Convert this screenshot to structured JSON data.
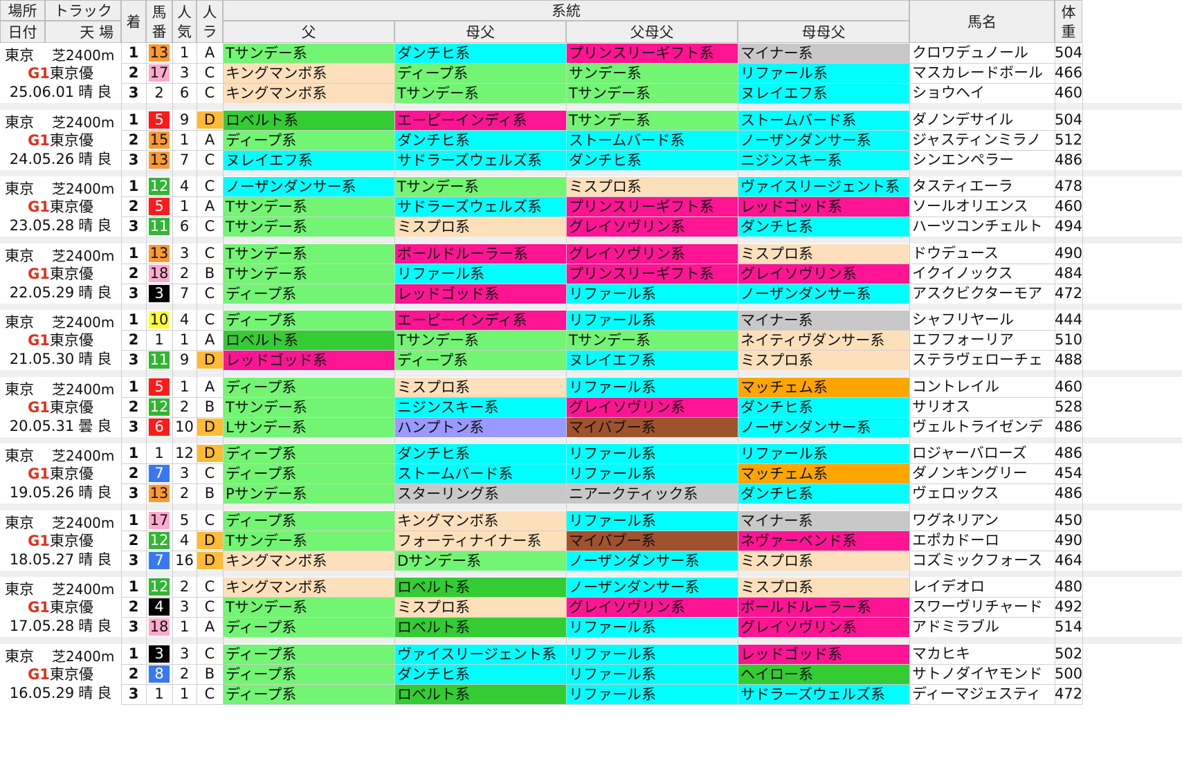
{
  "header": {
    "place": "場所",
    "date": "日付",
    "track": "トラック",
    "cond": "天 場",
    "rank": "着",
    "horse_no": "馬番",
    "popularity": "人気",
    "rank_class": "人ラ",
    "lineage": "系統",
    "sire": "父",
    "dam_sire": "母父",
    "sire_sire": "父母父",
    "dam_dam_sire": "母母父",
    "horse_name": "馬名",
    "weight": "体重"
  },
  "colors": {
    "Tサンデー系": "#72f572",
    "Lサンデー系": "#72f572",
    "Pサンデー系": "#72f572",
    "Dサンデー系": "#72f572",
    "ディープ系": "#72f572",
    "サンデー系": "#72f572",
    "キングマンボ系": "#fde0bb",
    "ミスプロ系": "#fde0bb",
    "ノーザンダンサー系": "#00ffff",
    "ストームバード系": "#00ffff",
    "ダンチヒ系": "#00ffff",
    "リファール系": "#00ffff",
    "ヌレイエフ系": "#00ffff",
    "ニジンスキー系": "#00ffff",
    "サドラーズウェルズ系": "#00ffff",
    "ヴァイスリージェント系": "#00ffff",
    "ロベルト系": "#33cc33",
    "ヘイロー系": "#33cc33",
    "エーピーインディ系": "#ff1493",
    "プリンスリーギフト系": "#ff1493",
    "レッドゴッド系": "#ff1493",
    "グレイソヴリン系": "#ff1493",
    "ボールドルーラー系": "#ff1493",
    "ネヴァーベンド系": "#ff1493",
    "マイナー系": "#c8c8c8",
    "スターリング系": "#c8c8c8",
    "ニアークティック系": "#c8c8c8",
    "マッチェム系": "#ffa500",
    "マイバブー系": "#a0522d",
    "ハンプトン系": "#9999ff",
    "ネイティヴダンサー系": "#fde0bb",
    "フォーティナイナー系": "#fde0bb",
    "no_colors": {
      "1": "#ffffff",
      "2": "#ffffff",
      "3": "#000000",
      "4": "#000000",
      "5": "#ff1a1a",
      "6": "#ff1a1a",
      "7": "#3a78f2",
      "8": "#3a78f2",
      "9": "#ffff33",
      "10": "#ffff33",
      "11": "#33b533",
      "12": "#33b533",
      "13": "#ff9933",
      "14": "#ff9933",
      "15": "#ff9933",
      "16": "#ffaacc",
      "17": "#ffaacc",
      "18": "#ffaacc"
    },
    "rank_d": "#ffbb33"
  },
  "races": [
    {
      "place": "東京",
      "track": "芝2400m",
      "grade": "G1",
      "race": "東京優",
      "date": "25.06.01",
      "weather": "晴",
      "going": "良",
      "rows": [
        {
          "rank": "1",
          "no": "13",
          "pop": "1",
          "cls": "A",
          "sire": "Tサンデー系",
          "dam_sire": "ダンチヒ系",
          "sire_sire": "プリンスリーギフト系",
          "dam_dam_sire": "マイナー系",
          "name": "クロワデュノール",
          "weight": "504"
        },
        {
          "rank": "2",
          "no": "17",
          "pop": "3",
          "cls": "C",
          "sire": "キングマンボ系",
          "dam_sire": "ディープ系",
          "sire_sire": "サンデー系",
          "dam_dam_sire": "リファール系",
          "name": "マスカレードボール",
          "weight": "466"
        },
        {
          "rank": "3",
          "no": "2",
          "pop": "6",
          "cls": "C",
          "sire": "キングマンボ系",
          "dam_sire": "Tサンデー系",
          "sire_sire": "Tサンデー系",
          "dam_dam_sire": "ヌレイエフ系",
          "name": "ショウヘイ",
          "weight": "460"
        }
      ]
    },
    {
      "place": "東京",
      "track": "芝2400m",
      "grade": "G1",
      "race": "東京優",
      "date": "24.05.26",
      "weather": "晴",
      "going": "良",
      "rows": [
        {
          "rank": "1",
          "no": "5",
          "pop": "9",
          "cls": "D",
          "sire": "ロベルト系",
          "dam_sire": "エーピーインディ系",
          "sire_sire": "Tサンデー系",
          "dam_dam_sire": "ストームバード系",
          "name": "ダノンデサイル",
          "weight": "504"
        },
        {
          "rank": "2",
          "no": "15",
          "pop": "1",
          "cls": "A",
          "sire": "ディープ系",
          "dam_sire": "ダンチヒ系",
          "sire_sire": "ストームバード系",
          "dam_dam_sire": "ノーザンダンサー系",
          "name": "ジャスティンミラノ",
          "weight": "512"
        },
        {
          "rank": "3",
          "no": "13",
          "pop": "7",
          "cls": "C",
          "sire": "ヌレイエフ系",
          "dam_sire": "サドラーズウェルズ系",
          "sire_sire": "ダンチヒ系",
          "dam_dam_sire": "ニジンスキー系",
          "name": "シンエンペラー",
          "weight": "486"
        }
      ]
    },
    {
      "place": "東京",
      "track": "芝2400m",
      "grade": "G1",
      "race": "東京優",
      "date": "23.05.28",
      "weather": "晴",
      "going": "良",
      "rows": [
        {
          "rank": "1",
          "no": "12",
          "pop": "4",
          "cls": "C",
          "sire": "ノーザンダンサー系",
          "dam_sire": "Tサンデー系",
          "sire_sire": "ミスプロ系",
          "dam_dam_sire": "ヴァイスリージェント系",
          "name": "タスティエーラ",
          "weight": "478"
        },
        {
          "rank": "2",
          "no": "5",
          "pop": "1",
          "cls": "A",
          "sire": "Tサンデー系",
          "dam_sire": "サドラーズウェルズ系",
          "sire_sire": "プリンスリーギフト系",
          "dam_dam_sire": "レッドゴッド系",
          "name": "ソールオリエンス",
          "weight": "460"
        },
        {
          "rank": "3",
          "no": "11",
          "pop": "6",
          "cls": "C",
          "sire": "Tサンデー系",
          "dam_sire": "ミスプロ系",
          "sire_sire": "グレイソヴリン系",
          "dam_dam_sire": "ダンチヒ系",
          "name": "ハーツコンチェルト",
          "weight": "494"
        }
      ]
    },
    {
      "place": "東京",
      "track": "芝2400m",
      "grade": "G1",
      "race": "東京優",
      "date": "22.05.29",
      "weather": "晴",
      "going": "良",
      "rows": [
        {
          "rank": "1",
          "no": "13",
          "pop": "3",
          "cls": "C",
          "sire": "Tサンデー系",
          "dam_sire": "ボールドルーラー系",
          "sire_sire": "グレイソヴリン系",
          "dam_dam_sire": "ミスプロ系",
          "name": "ドウデュース",
          "weight": "490"
        },
        {
          "rank": "2",
          "no": "18",
          "pop": "2",
          "cls": "B",
          "sire": "Tサンデー系",
          "dam_sire": "リファール系",
          "sire_sire": "プリンスリーギフト系",
          "dam_dam_sire": "グレイソヴリン系",
          "name": "イクイノックス",
          "weight": "484"
        },
        {
          "rank": "3",
          "no": "3",
          "pop": "7",
          "cls": "C",
          "sire": "ディープ系",
          "dam_sire": "レッドゴッド系",
          "sire_sire": "リファール系",
          "dam_dam_sire": "ノーザンダンサー系",
          "name": "アスクビクターモア",
          "weight": "472"
        }
      ]
    },
    {
      "place": "東京",
      "track": "芝2400m",
      "grade": "G1",
      "race": "東京優",
      "date": "21.05.30",
      "weather": "晴",
      "going": "良",
      "rows": [
        {
          "rank": "1",
          "no": "10",
          "pop": "4",
          "cls": "C",
          "sire": "ディープ系",
          "dam_sire": "エーピーインディ系",
          "sire_sire": "リファール系",
          "dam_dam_sire": "マイナー系",
          "name": "シャフリヤール",
          "weight": "444"
        },
        {
          "rank": "2",
          "no": "1",
          "pop": "1",
          "cls": "A",
          "sire": "ロベルト系",
          "dam_sire": "Tサンデー系",
          "sire_sire": "Tサンデー系",
          "dam_dam_sire": "ネイティヴダンサー系",
          "name": "エフフォーリア",
          "weight": "510"
        },
        {
          "rank": "3",
          "no": "11",
          "pop": "9",
          "cls": "D",
          "sire": "レッドゴッド系",
          "dam_sire": "ディープ系",
          "sire_sire": "ヌレイエフ系",
          "dam_dam_sire": "ミスプロ系",
          "name": "ステラヴェローチェ",
          "weight": "488"
        }
      ]
    },
    {
      "place": "東京",
      "track": "芝2400m",
      "grade": "G1",
      "race": "東京優",
      "date": "20.05.31",
      "weather": "曇",
      "going": "良",
      "rows": [
        {
          "rank": "1",
          "no": "5",
          "pop": "1",
          "cls": "A",
          "sire": "ディープ系",
          "dam_sire": "ミスプロ系",
          "sire_sire": "リファール系",
          "dam_dam_sire": "マッチェム系",
          "name": "コントレイル",
          "weight": "460"
        },
        {
          "rank": "2",
          "no": "12",
          "pop": "2",
          "cls": "B",
          "sire": "Tサンデー系",
          "dam_sire": "ニジンスキー系",
          "sire_sire": "グレイソヴリン系",
          "dam_dam_sire": "ダンチヒ系",
          "name": "サリオス",
          "weight": "528"
        },
        {
          "rank": "3",
          "no": "6",
          "pop": "10",
          "cls": "D",
          "sire": "Lサンデー系",
          "dam_sire": "ハンプトン系",
          "sire_sire": "マイバブー系",
          "dam_dam_sire": "ノーザンダンサー系",
          "name": "ヴェルトライゼンデ",
          "weight": "486"
        }
      ]
    },
    {
      "place": "東京",
      "track": "芝2400m",
      "grade": "G1",
      "race": "東京優",
      "date": "19.05.26",
      "weather": "晴",
      "going": "良",
      "rows": [
        {
          "rank": "1",
          "no": "1",
          "pop": "12",
          "cls": "D",
          "sire": "ディープ系",
          "dam_sire": "ダンチヒ系",
          "sire_sire": "リファール系",
          "dam_dam_sire": "リファール系",
          "name": "ロジャーバローズ",
          "weight": "486"
        },
        {
          "rank": "2",
          "no": "7",
          "pop": "3",
          "cls": "C",
          "sire": "ディープ系",
          "dam_sire": "ストームバード系",
          "sire_sire": "リファール系",
          "dam_dam_sire": "マッチェム系",
          "name": "ダノンキングリー",
          "weight": "454"
        },
        {
          "rank": "3",
          "no": "13",
          "pop": "2",
          "cls": "B",
          "sire": "Pサンデー系",
          "dam_sire": "スターリング系",
          "sire_sire": "ニアークティック系",
          "dam_dam_sire": "ダンチヒ系",
          "name": "ヴェロックス",
          "weight": "486"
        }
      ]
    },
    {
      "place": "東京",
      "track": "芝2400m",
      "grade": "G1",
      "race": "東京優",
      "date": "18.05.27",
      "weather": "晴",
      "going": "良",
      "rows": [
        {
          "rank": "1",
          "no": "17",
          "pop": "5",
          "cls": "C",
          "sire": "ディープ系",
          "dam_sire": "キングマンボ系",
          "sire_sire": "リファール系",
          "dam_dam_sire": "マイナー系",
          "name": "ワグネリアン",
          "weight": "450"
        },
        {
          "rank": "2",
          "no": "12",
          "pop": "4",
          "cls": "D",
          "sire": "Tサンデー系",
          "dam_sire": "フォーティナイナー系",
          "sire_sire": "マイバブー系",
          "dam_dam_sire": "ネヴァーベンド系",
          "name": "エポカドーロ",
          "weight": "490"
        },
        {
          "rank": "3",
          "no": "7",
          "pop": "16",
          "cls": "D",
          "sire": "キングマンボ系",
          "dam_sire": "Dサンデー系",
          "sire_sire": "ノーザンダンサー系",
          "dam_dam_sire": "ミスプロ系",
          "name": "コズミックフォース",
          "weight": "464"
        }
      ]
    },
    {
      "place": "東京",
      "track": "芝2400m",
      "grade": "G1",
      "race": "東京優",
      "date": "17.05.28",
      "weather": "晴",
      "going": "良",
      "rows": [
        {
          "rank": "1",
          "no": "12",
          "pop": "2",
          "cls": "C",
          "sire": "キングマンボ系",
          "dam_sire": "ロベルト系",
          "sire_sire": "ノーザンダンサー系",
          "dam_dam_sire": "ミスプロ系",
          "name": "レイデオロ",
          "weight": "480"
        },
        {
          "rank": "2",
          "no": "4",
          "pop": "3",
          "cls": "C",
          "sire": "Tサンデー系",
          "dam_sire": "ミスプロ系",
          "sire_sire": "グレイソヴリン系",
          "dam_dam_sire": "ボールドルーラー系",
          "name": "スワーヴリチャード",
          "weight": "492"
        },
        {
          "rank": "3",
          "no": "18",
          "pop": "1",
          "cls": "A",
          "sire": "ディープ系",
          "dam_sire": "ロベルト系",
          "sire_sire": "リファール系",
          "dam_dam_sire": "グレイソヴリン系",
          "name": "アドミラブル",
          "weight": "514"
        }
      ]
    },
    {
      "place": "東京",
      "track": "芝2400m",
      "grade": "G1",
      "race": "東京優",
      "date": "16.05.29",
      "weather": "晴",
      "going": "良",
      "rows": [
        {
          "rank": "1",
          "no": "3",
          "pop": "3",
          "cls": "C",
          "sire": "ディープ系",
          "dam_sire": "ヴァイスリージェント系",
          "sire_sire": "リファール系",
          "dam_dam_sire": "レッドゴッド系",
          "name": "マカヒキ",
          "weight": "502"
        },
        {
          "rank": "2",
          "no": "8",
          "pop": "2",
          "cls": "B",
          "sire": "ディープ系",
          "dam_sire": "ダンチヒ系",
          "sire_sire": "リファール系",
          "dam_dam_sire": "ヘイロー系",
          "name": "サトノダイヤモンド",
          "weight": "500"
        },
        {
          "rank": "3",
          "no": "1",
          "pop": "1",
          "cls": "C",
          "sire": "ディープ系",
          "dam_sire": "ロベルト系",
          "sire_sire": "リファール系",
          "dam_dam_sire": "サドラーズウェルズ系",
          "name": "ディーマジェスティ",
          "weight": "472"
        }
      ]
    }
  ]
}
